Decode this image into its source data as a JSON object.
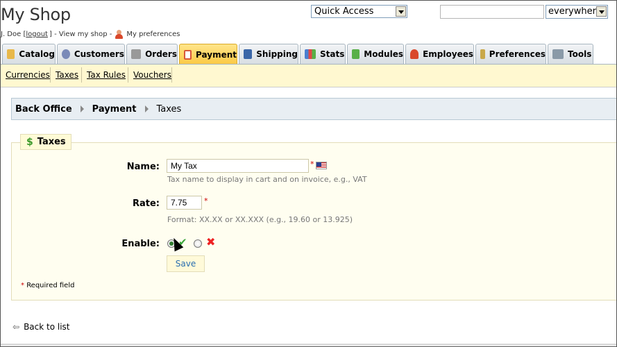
{
  "header": {
    "shop_title": "My Shop",
    "user_prefix": "J. Doe [",
    "logout": "logout",
    "user_mid": "] - View my shop -",
    "preferences": "My preferences",
    "quick_access": "Quick Access",
    "search_value": "",
    "search_scope": "everywhere"
  },
  "tabs": [
    {
      "label": "Catalog",
      "icon": "folder-icon",
      "color": "#e8b84a"
    },
    {
      "label": "Customers",
      "icon": "customer-icon",
      "color": "#7a8ab8"
    },
    {
      "label": "Orders",
      "icon": "cart-icon",
      "color": "#999999"
    },
    {
      "label": "Payment",
      "icon": "payment-icon",
      "color": "#d8573a",
      "active": true
    },
    {
      "label": "Shipping",
      "icon": "truck-icon",
      "color": "#3a66a8"
    },
    {
      "label": "Stats",
      "icon": "chart-icon",
      "color": "#4a7fd0"
    },
    {
      "label": "Modules",
      "icon": "puzzle-icon",
      "color": "#58b048"
    },
    {
      "label": "Employees",
      "icon": "employee-icon",
      "color": "#d9482b"
    },
    {
      "label": "Preferences",
      "icon": "preferences-icon",
      "color": "#c9a84a"
    },
    {
      "label": "Tools",
      "icon": "wrench-icon",
      "color": "#8a9aa8"
    }
  ],
  "submenu": [
    "Currencies",
    "Taxes",
    "Tax Rules",
    "Vouchers"
  ],
  "breadcrumb": [
    "Back Office",
    "Payment",
    "Taxes"
  ],
  "form": {
    "legend": "Taxes",
    "name_label": "Name:",
    "name_value": "My Tax",
    "name_hint": "Tax name to display in cart and on invoice, e.g., VAT",
    "rate_label": "Rate:",
    "rate_value": "7.75",
    "rate_hint": "Format: XX.XX or XX.XXX (e.g., 19.60 or 13.925)",
    "enable_label": "Enable:",
    "required_star": "*",
    "save_label": "Save",
    "required_note": "Required field"
  },
  "back_link": "Back to list",
  "colors": {
    "active_tab": "#fcc944",
    "submenu_bg": "#fff8d0",
    "breadcrumb_bg": "#e8eef3",
    "panel_bg": "#fffef0"
  }
}
